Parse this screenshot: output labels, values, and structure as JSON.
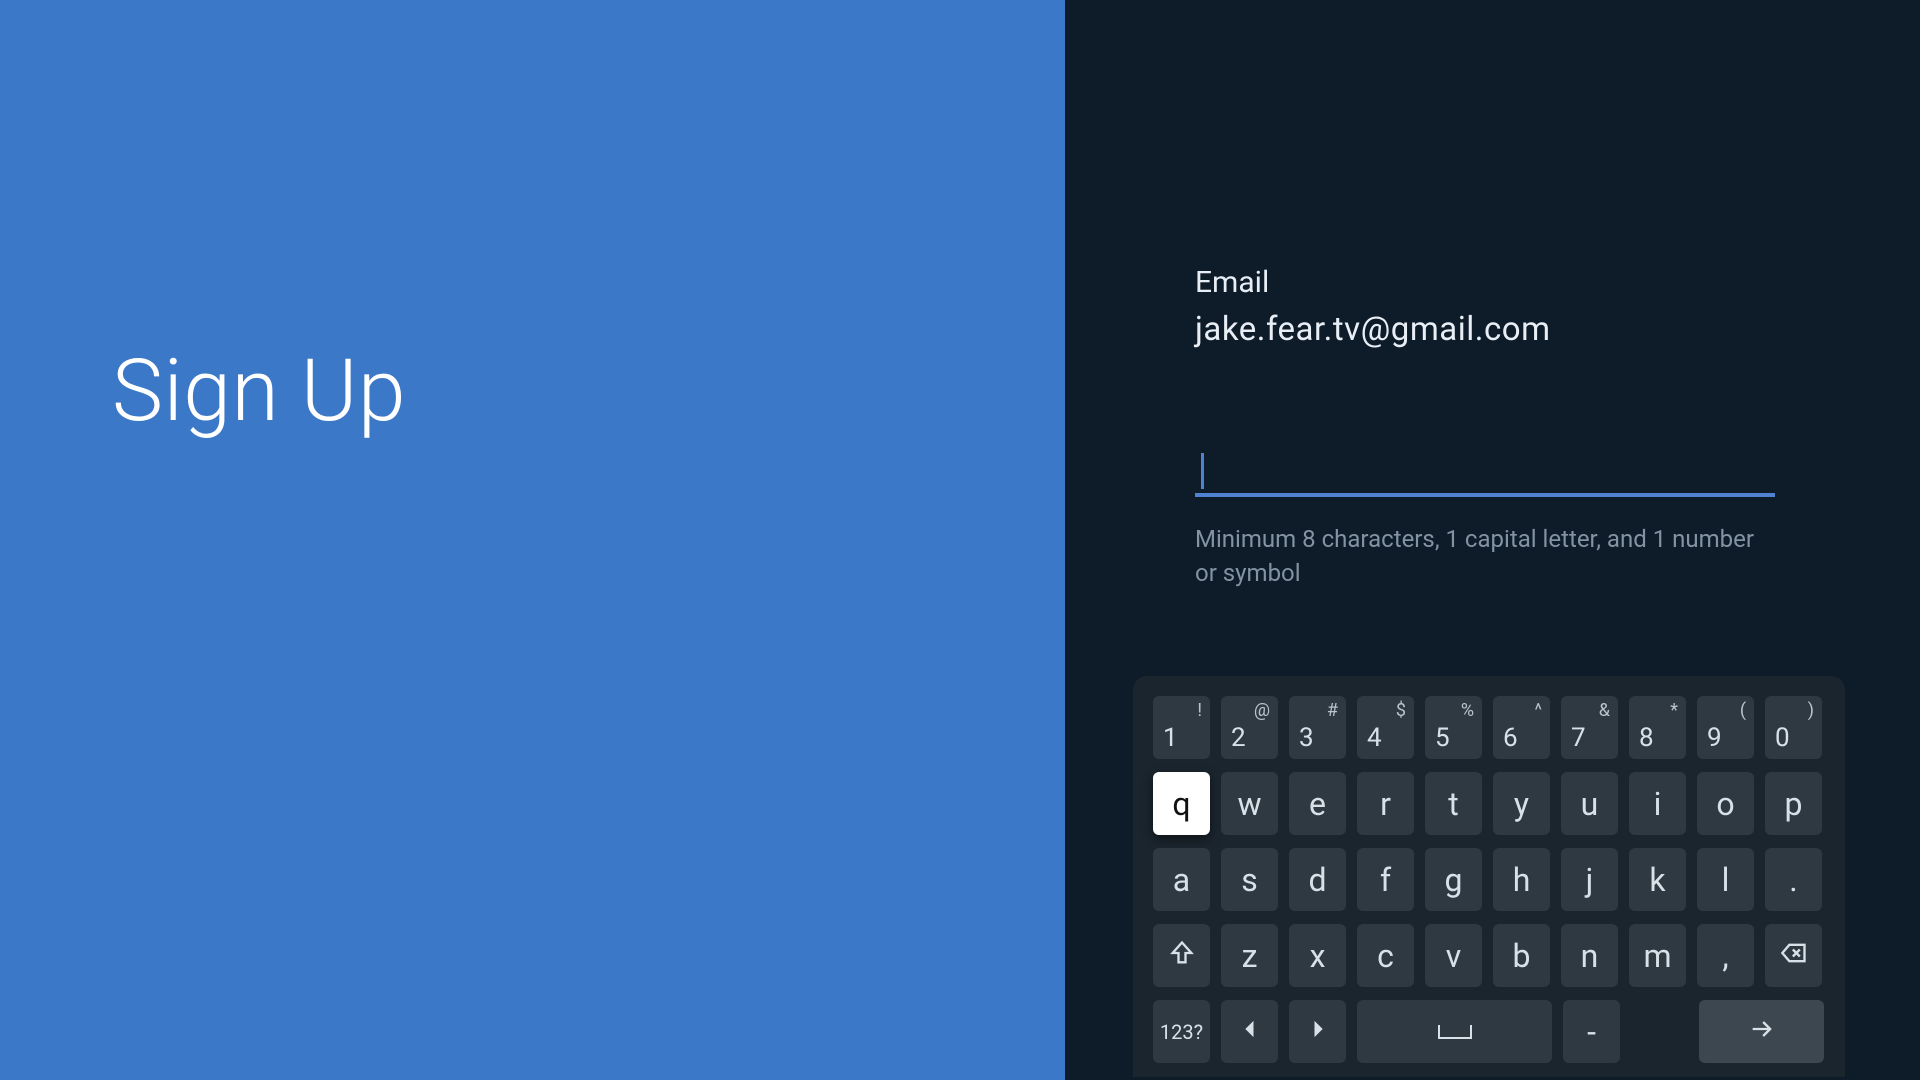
{
  "left": {
    "title": "Sign Up"
  },
  "form": {
    "email_label": "Email",
    "email_value": "jake.fear.tv@gmail.com",
    "password_value": "",
    "hint": "Minimum 8 characters, 1 capital letter, and 1 number or symbol"
  },
  "keyboard": {
    "row1": [
      {
        "main": "1",
        "sup": "!"
      },
      {
        "main": "2",
        "sup": "@"
      },
      {
        "main": "3",
        "sup": "#"
      },
      {
        "main": "4",
        "sup": "$"
      },
      {
        "main": "5",
        "sup": "%"
      },
      {
        "main": "6",
        "sup": "^"
      },
      {
        "main": "7",
        "sup": "&"
      },
      {
        "main": "8",
        "sup": "*"
      },
      {
        "main": "9",
        "sup": "("
      },
      {
        "main": "0",
        "sup": ")"
      }
    ],
    "row2": [
      "q",
      "w",
      "e",
      "r",
      "t",
      "y",
      "u",
      "i",
      "o",
      "p"
    ],
    "row2_focused_index": 0,
    "row3": [
      "a",
      "s",
      "d",
      "f",
      "g",
      "h",
      "j",
      "k",
      "l",
      "."
    ],
    "row4_letters": [
      "z",
      "x",
      "c",
      "v",
      "b",
      "n",
      "m",
      ","
    ],
    "mode_label": "123?",
    "dash_label": "-"
  },
  "icons": {
    "shift": "shift-icon",
    "backspace": "backspace-icon",
    "left": "caret-left-icon",
    "right": "caret-right-icon",
    "space": "space-icon",
    "enter": "arrow-right-icon"
  }
}
